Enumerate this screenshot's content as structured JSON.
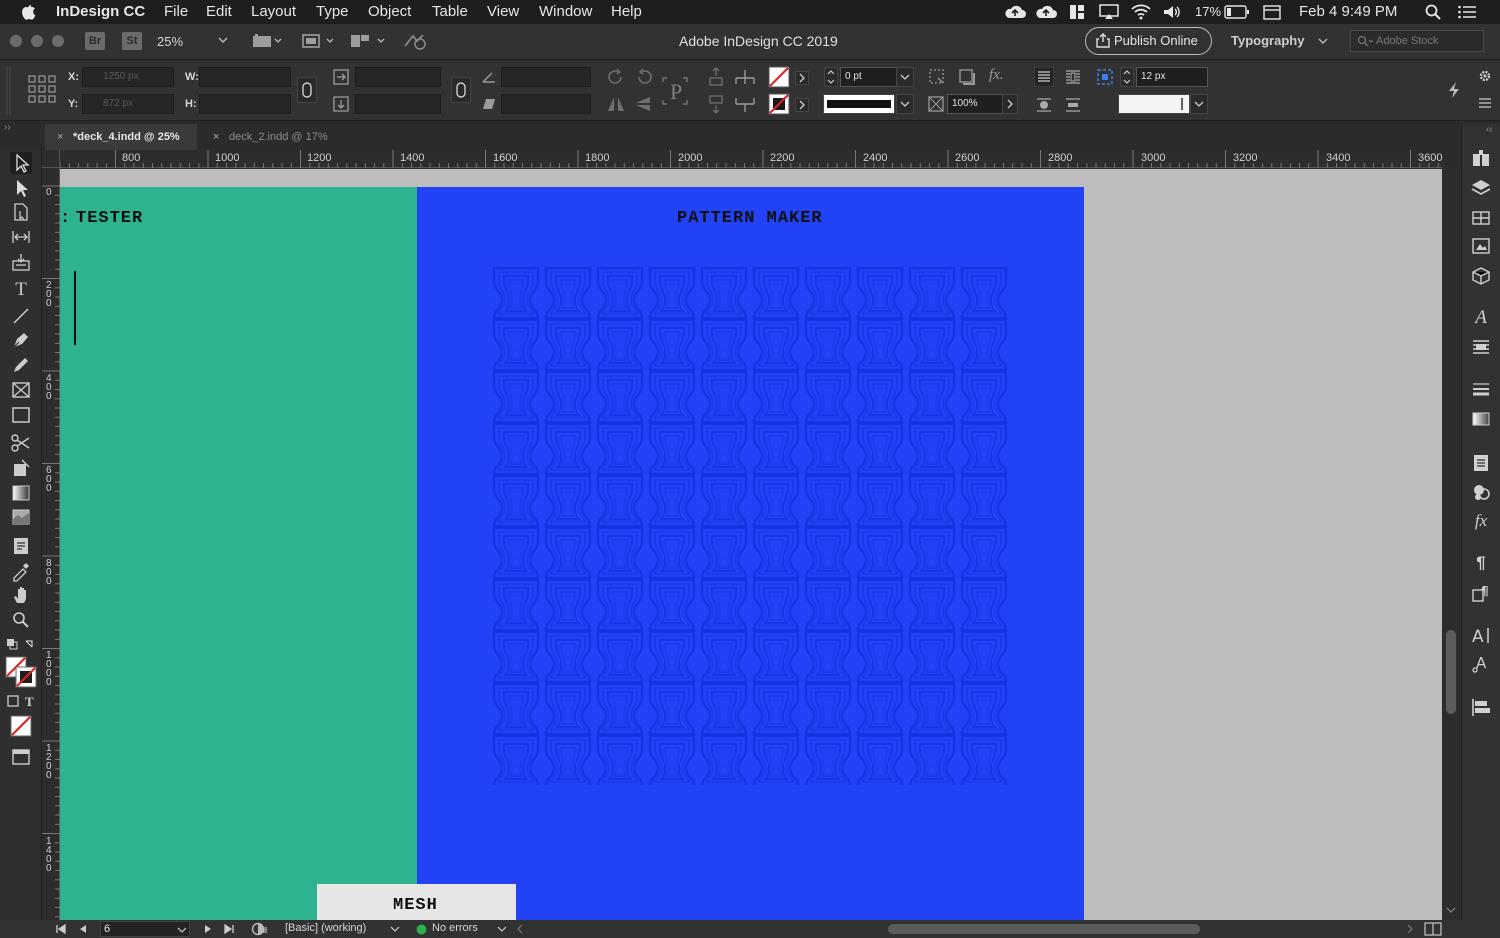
{
  "menubar": {
    "app_name": "InDesign CC",
    "items": [
      "File",
      "Edit",
      "Layout",
      "Type",
      "Object",
      "Table",
      "View",
      "Window",
      "Help"
    ],
    "battery": "17%",
    "clock": "Feb 4  9:49 PM"
  },
  "appbar": {
    "bridge_label": "Br",
    "stock_label": "St",
    "zoom": "25%",
    "window_title": "Adobe InDesign CC 2019",
    "publish_label": "Publish Online",
    "workspace": "Typography",
    "search_placeholder": "Adobe Stock"
  },
  "control": {
    "x_label": "X:",
    "y_label": "Y:",
    "w_label": "W:",
    "h_label": "H:",
    "x_value": "1250 px",
    "y_value": "872 px",
    "stroke_weight": "0 pt",
    "opacity": "100%",
    "spacing": "12 px"
  },
  "tabs": [
    {
      "label": "*deck_4.indd @ 25%",
      "active": true
    },
    {
      "label": "deck_2.indd @ 17%",
      "active": false
    }
  ],
  "ruler": {
    "h_ticks": [
      "800",
      "1000",
      "1200",
      "1400",
      "1600",
      "1800",
      "2000",
      "2200",
      "2400",
      "2600",
      "2800",
      "3000",
      "3200",
      "3400",
      "3600"
    ],
    "v_ticks": [
      "0",
      "200",
      "400",
      "600",
      "800",
      "1000",
      "1200",
      "1400"
    ]
  },
  "document": {
    "left_title": "TESTER",
    "left_prefix": ":",
    "center_title": "PATTERN MAKER",
    "bottom_label": "MESH",
    "colors": {
      "green": "#2db390",
      "blue": "#2243f5",
      "pasteboard": "#bdbdbd"
    }
  },
  "status": {
    "page": "6",
    "preflight_profile": "[Basic] (working)",
    "errors": "No errors"
  }
}
